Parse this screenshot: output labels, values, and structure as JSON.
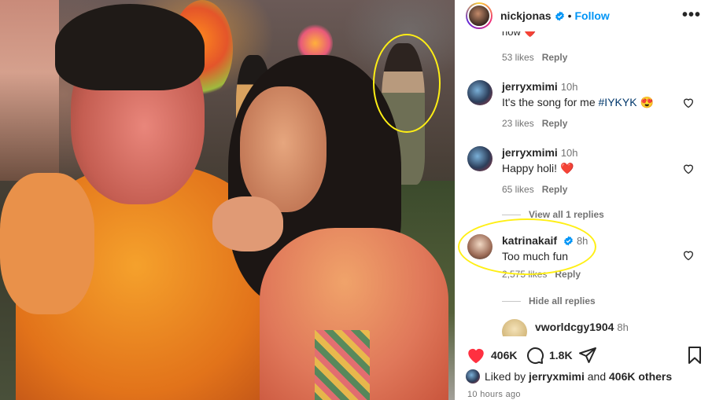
{
  "post": {
    "username": "nickjonas",
    "verified": true,
    "follow_label": "Follow",
    "more_label": "•••"
  },
  "comments": {
    "truncated_text": "now ❤️",
    "top_meta": {
      "likes": "53 likes",
      "reply": "Reply"
    },
    "items": [
      {
        "username": "jerryxmimi",
        "time": "10h",
        "text": "It's the song for me ",
        "hashtag": "#IYKYK",
        "emoji": "😍",
        "likes": "23 likes",
        "reply": "Reply"
      },
      {
        "username": "jerryxmimi",
        "time": "10h",
        "text": "Happy holi! ",
        "emoji": "❤️",
        "likes": "65 likes",
        "reply": "Reply"
      }
    ],
    "view_replies": "View all 1 replies",
    "reply": {
      "username": "katrinakaif",
      "verified": true,
      "time": "8h",
      "text": "Too much fun",
      "likes": "2,575 likes",
      "reply": "Reply"
    },
    "hide_replies": "Hide all replies",
    "next": {
      "username": "vworldcgy1904",
      "time": "8h"
    }
  },
  "actions": {
    "likes_count": "406K",
    "comments_count": "1.8K"
  },
  "liked_by": {
    "prefix": "Liked by ",
    "user": "jerryxmimi",
    "middle": " and ",
    "others": "406K others"
  },
  "posted_ago": "10 hours ago",
  "colors": {
    "accent_blue": "#0095f6",
    "like_red": "#ff3040",
    "annotation_yellow": "#ffef15",
    "text_primary": "#262626",
    "text_secondary": "#737373"
  },
  "icons": [
    "verified-badge-icon",
    "more-options-icon",
    "heart-icon",
    "comment-icon",
    "share-icon",
    "bookmark-icon"
  ]
}
